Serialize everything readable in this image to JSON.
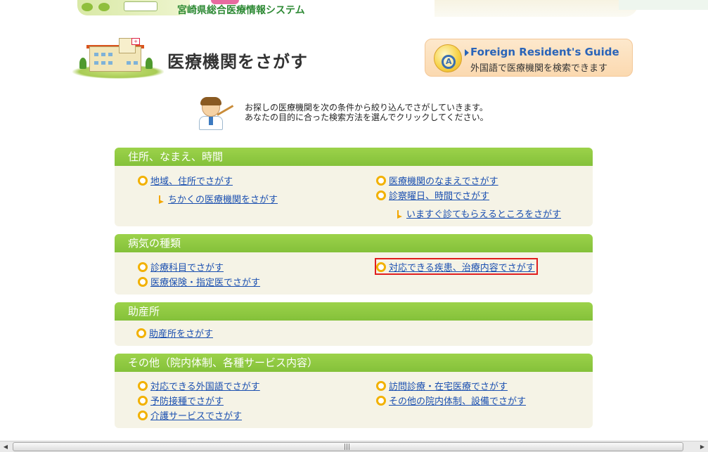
{
  "header": {
    "system_title": "宮崎県総合医療情報システム"
  },
  "page": {
    "title": "医療機関をさがす"
  },
  "guide": {
    "title": "Foreign Resident's Guide",
    "subtitle": "外国語で医療機関を検索できます"
  },
  "instruction": {
    "line1": "お探しの医療機関を次の条件から絞り込んでさがしていきます。",
    "line2": "あなたの目的に合った検索方法を選んでクリックしてください。"
  },
  "sections": [
    {
      "title": "住所、なまえ、時間",
      "links": {
        "region": "地域、住所でさがす",
        "nearby": "ちかくの医療機関をさがす",
        "name": "医療機関のなまえでさがす",
        "day_time": "診察曜日、時間でさがす",
        "now": "いますぐ診てもらえるところをさがす"
      }
    },
    {
      "title": "病気の種類",
      "links": {
        "department": "診療科目でさがす",
        "insurance": "医療保険・指定医でさがす",
        "disease": "対応できる疾患、治療内容でさがす"
      }
    },
    {
      "title": "助産所",
      "links": {
        "midwife": "助産所をさがす"
      }
    },
    {
      "title": "その他（院内体制、各種サービス内容）",
      "links": {
        "language": "対応できる外国語でさがす",
        "vaccination": "予防接種でさがす",
        "care": "介護サービスでさがす",
        "home": "訪問診療・在宅医療でさがす",
        "facility": "その他の院内体制、設備でさがす"
      }
    }
  ],
  "scrollbar": {
    "left_glyph": "◀",
    "right_glyph": "▶",
    "grip_glyph": "|||"
  }
}
